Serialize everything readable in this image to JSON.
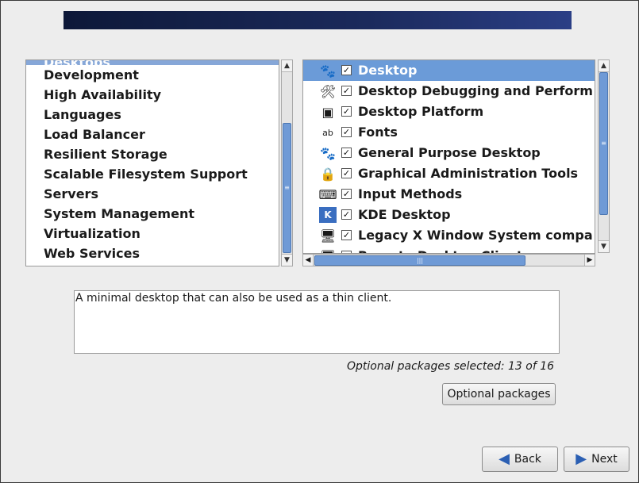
{
  "groups": {
    "partial_item": "Desktops",
    "items": [
      "Development",
      "High Availability",
      "Languages",
      "Load Balancer",
      "Resilient Storage",
      "Scalable Filesystem Support",
      "Servers",
      "System Management",
      "Virtualization",
      "Web Services"
    ]
  },
  "packages": [
    {
      "name": "Desktop",
      "checked": true,
      "selected": true,
      "icon": "gnome-foot-icon"
    },
    {
      "name": "Desktop Debugging and Perform",
      "checked": true,
      "icon": "tools-icon"
    },
    {
      "name": "Desktop Platform",
      "checked": true,
      "icon": "platform-icon"
    },
    {
      "name": "Fonts",
      "checked": true,
      "icon": "fonts-icon"
    },
    {
      "name": "General Purpose Desktop",
      "checked": true,
      "icon": "gnome-foot-icon"
    },
    {
      "name": "Graphical Administration Tools",
      "checked": true,
      "icon": "admin-lock-icon"
    },
    {
      "name": "Input Methods",
      "checked": true,
      "icon": "keyboard-icon"
    },
    {
      "name": "KDE Desktop",
      "checked": true,
      "icon": "kde-icon"
    },
    {
      "name": "Legacy X Window System compa",
      "checked": true,
      "icon": "monitor-icon"
    },
    {
      "name": "Remote Desktop Clients",
      "checked": true,
      "icon": "remote-desktop-icon"
    }
  ],
  "description": "A minimal desktop that can also be used as a thin client.",
  "optional_count_text": "Optional packages selected: 13 of 16",
  "buttons": {
    "optional_packages": "Optional packages",
    "back": "Back",
    "next": "Next"
  },
  "colors": {
    "selection": "#6b9bd8",
    "banner": "#0d1838"
  }
}
